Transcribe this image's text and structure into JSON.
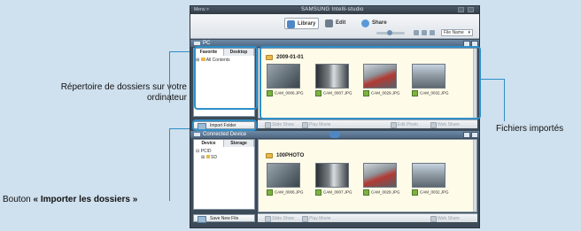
{
  "annotations": {
    "folders": "Répertoire de dossiers sur votre ordinateur",
    "imported_files": "Fichiers importés",
    "import_button_prefix": "Bouton",
    "import_button_bold": "« Importer les dossiers »"
  },
  "window": {
    "title": "Menu >",
    "brand": "SAMSUNG Intelli-studio"
  },
  "toolbar": {
    "library": "Library",
    "edit": "Edit",
    "share": "Share",
    "sort": "File Name"
  },
  "pc_panel": {
    "title": "PC",
    "tabs": [
      "Favorite",
      "Desktop"
    ],
    "tree": [
      "All Contents"
    ],
    "import_button": "Import Folder",
    "folder": "2009-01-01",
    "files": [
      "CAM_0006.JPG",
      "CAM_0007.JPG",
      "CAM_0029.JPG",
      "CAM_0032.JPG"
    ],
    "actions": [
      "Slide Show",
      "Play Movie",
      "Edit Photo",
      "Web Share"
    ]
  },
  "device_panel": {
    "title": "Connected Device",
    "tabs": [
      "Device",
      "Storage"
    ],
    "tree": [
      "PCID",
      "SD"
    ],
    "save_button": "Save New File",
    "folder": "100PHOTO",
    "files": [
      "CAM_0006.JPG",
      "CAM_0007.JPG",
      "CAM_0029.JPG",
      "CAM_0032.JPG"
    ],
    "actions": [
      "Slide Show",
      "Play Movie",
      "Web Share"
    ]
  },
  "colors": {
    "annotation_line": "#2e8fc8",
    "panel_header": "#5a7491",
    "content_bg": "#fffbe9"
  }
}
